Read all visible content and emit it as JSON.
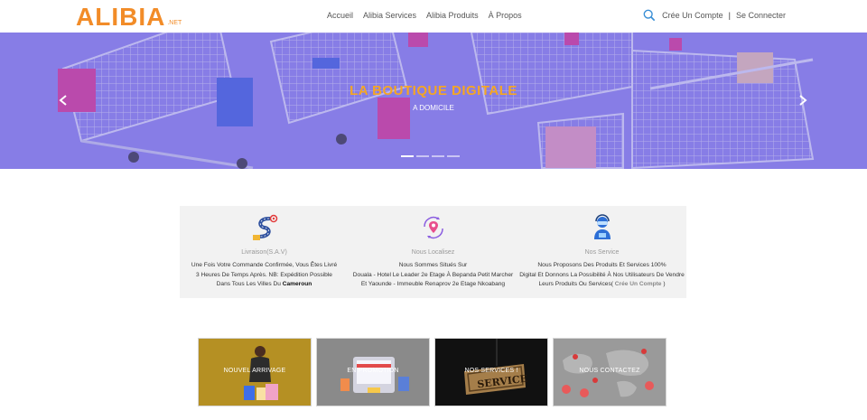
{
  "header": {
    "logo": {
      "main": "ALIBIA",
      "ext": ".NET"
    },
    "nav": [
      {
        "label": "Accueil"
      },
      {
        "label": "Alibia Services"
      },
      {
        "label": "Alibia Produits"
      },
      {
        "label": "À Propos"
      }
    ],
    "account": {
      "signup": "Crée Un Compte",
      "separator": "|",
      "login": "Se Connecter"
    }
  },
  "hero": {
    "title": "LA BOUTIQUE DIGITALE",
    "subtitle": "A DOMICILE",
    "slide_count": 4,
    "active_slide": 1,
    "colors": {
      "background": "#8f86e6",
      "title": "#f5a623"
    }
  },
  "info": {
    "columns": [
      {
        "icon": "delivery-route-icon",
        "title": "Livraison(S.A.V)",
        "lines": [
          "Une Fois Votre Commande Confirmée, Vous Êtes Livré",
          "3 Heures De Temps Après. NB: Expédition Possible"
        ],
        "last_line_prefix": "Dans Tous Les Villes Du ",
        "last_line_bold": "Cameroun"
      },
      {
        "icon": "location-pin-icon",
        "title": "Nous Localisez",
        "lines": [
          "Nous Sommes Situés Sur",
          "Douala - Hotel Le Leader 2e Etage À Bepanda Petit Marcher",
          "Et Yaounde - Immeuble Renaprov 2e Etage Nkoabang"
        ]
      },
      {
        "icon": "support-agent-icon",
        "title": "Nos Service",
        "lines": [
          "Nous Proposons Des Produits Et Services 100%",
          "Digital Et Donnons La Possibilité À Nos Utilisateurs De Vendre"
        ],
        "last_line_prefix": "Leurs Produits Ou Services(",
        "last_line_link": "Crée Un Compte",
        "last_line_suffix": ")"
      }
    ]
  },
  "cards": [
    {
      "label": "NOUVEL ARRIVAGE"
    },
    {
      "label": "EN PROMOTION"
    },
    {
      "label": "NOS SERVICES !"
    },
    {
      "label": "NOUS CONTACTEZ"
    }
  ]
}
